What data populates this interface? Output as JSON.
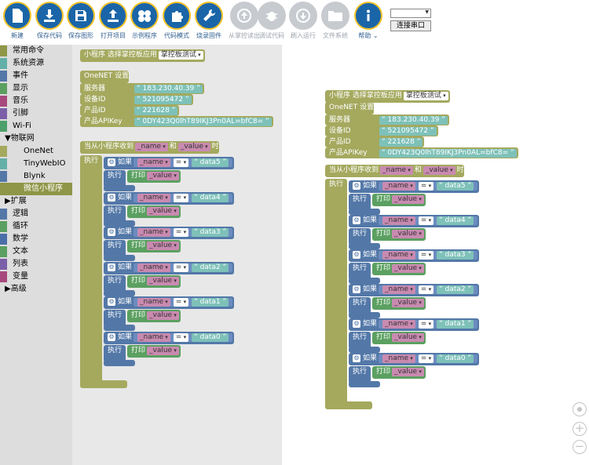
{
  "toolbar": {
    "buttons": [
      {
        "label": "新建",
        "icon": "new-file-icon",
        "enabled": true
      },
      {
        "label": "保存代码",
        "icon": "download-icon",
        "enabled": true
      },
      {
        "label": "保存图形",
        "icon": "floppy-icon",
        "enabled": true
      },
      {
        "label": "打开项目",
        "icon": "upload-icon",
        "enabled": true
      },
      {
        "label": "示例程序",
        "icon": "puzzle-icon",
        "enabled": true
      },
      {
        "label": "代码模式",
        "icon": "puzzle-piece-icon",
        "enabled": true
      },
      {
        "label": "烧录固件",
        "icon": "wrench-icon",
        "enabled": true
      },
      {
        "label": "从掌控读出",
        "icon": "arrow-up-circle-icon",
        "enabled": false
      },
      {
        "label": "调试代码",
        "icon": "bug-icon",
        "enabled": false
      },
      {
        "label": "刷入运行",
        "icon": "arrow-down-circle-icon",
        "enabled": false
      },
      {
        "label": "文件系统",
        "icon": "folder-icon",
        "enabled": false
      },
      {
        "label": "帮助 ⌄",
        "icon": "info-icon",
        "enabled": true
      }
    ],
    "connect_label": "连接串口"
  },
  "sidebar": {
    "items": [
      {
        "label": "常用命令",
        "color": "#8f9647",
        "indent": 0
      },
      {
        "label": "系统资源",
        "color": "#63b0a8",
        "indent": 0
      },
      {
        "label": "事件",
        "color": "#5378a8",
        "indent": 0
      },
      {
        "label": "显示",
        "color": "#5ba061",
        "indent": 0
      },
      {
        "label": "音乐",
        "color": "#a8497e",
        "indent": 0
      },
      {
        "label": "引脚",
        "color": "#7b5fa8",
        "indent": 0
      },
      {
        "label": "Wi-Fi",
        "color": "#4ea06a",
        "indent": 0
      },
      {
        "label": "▼物联网",
        "color": "",
        "indent": 0
      },
      {
        "label": "OneNet",
        "color": "#a4a95e",
        "indent": 1
      },
      {
        "label": "TinyWebIO",
        "color": "#63b0a8",
        "indent": 1
      },
      {
        "label": "Blynk",
        "color": "#5378a8",
        "indent": 1
      },
      {
        "label": "微信小程序",
        "color": "#8f9647",
        "indent": 1,
        "selected": true
      },
      {
        "label": "▶扩展",
        "color": "",
        "indent": 0
      },
      {
        "label": "逻辑",
        "color": "#5378a8",
        "indent": 0
      },
      {
        "label": "循环",
        "color": "#5ba061",
        "indent": 0
      },
      {
        "label": "数学",
        "color": "#4a6fa8",
        "indent": 0
      },
      {
        "label": "文本",
        "color": "#5ba061",
        "indent": 0
      },
      {
        "label": "列表",
        "color": "#7b5fa8",
        "indent": 0
      },
      {
        "label": "变量",
        "color": "#a8497e",
        "indent": 0
      },
      {
        "label": "▶高级",
        "color": "",
        "indent": 0
      }
    ]
  },
  "blocks": {
    "mini_prog": "小程序",
    "select_app": "选择掌控板应用",
    "app_value": "掌控板测试",
    "onenet_setup": "OneNET 设置",
    "server_label": "服务器",
    "server_value": "183.230.40.39",
    "device_label": "设备ID",
    "device_value": "521095472",
    "product_label": "产品ID",
    "product_value": "221628",
    "apikey_label": "产品APIKey",
    "apikey_value": "0DY423Q0lhT89IKJ3Pn0AL=bfC8=",
    "receive_label": "当从小程序收到",
    "name_var": "_name",
    "and_label": "和",
    "value_var": "_value",
    "when_label": "时",
    "exec_label": "执行",
    "if_label": "如果",
    "eq_op": "=",
    "print_label": "打印",
    "conditions": [
      "data5",
      "data4",
      "data3",
      "data2",
      "data1",
      "data0"
    ]
  }
}
